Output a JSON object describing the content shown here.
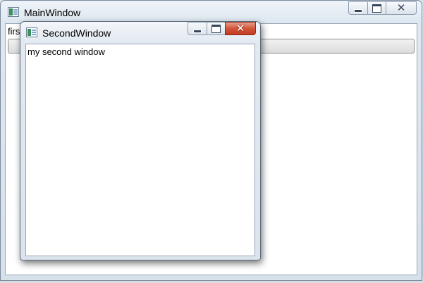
{
  "main_window": {
    "title": "MainWindow",
    "content_text": "firs",
    "controls": {
      "minimize": "minimize-icon",
      "maximize": "maximize-icon",
      "close": "close-icon"
    }
  },
  "second_window": {
    "title": "SecondWindow",
    "content_text": "my second window",
    "controls": {
      "minimize": "minimize-icon",
      "maximize": "maximize-icon",
      "close": "close-icon"
    },
    "close_color": "#c8452a"
  },
  "glyphs": {
    "close": "✕"
  }
}
